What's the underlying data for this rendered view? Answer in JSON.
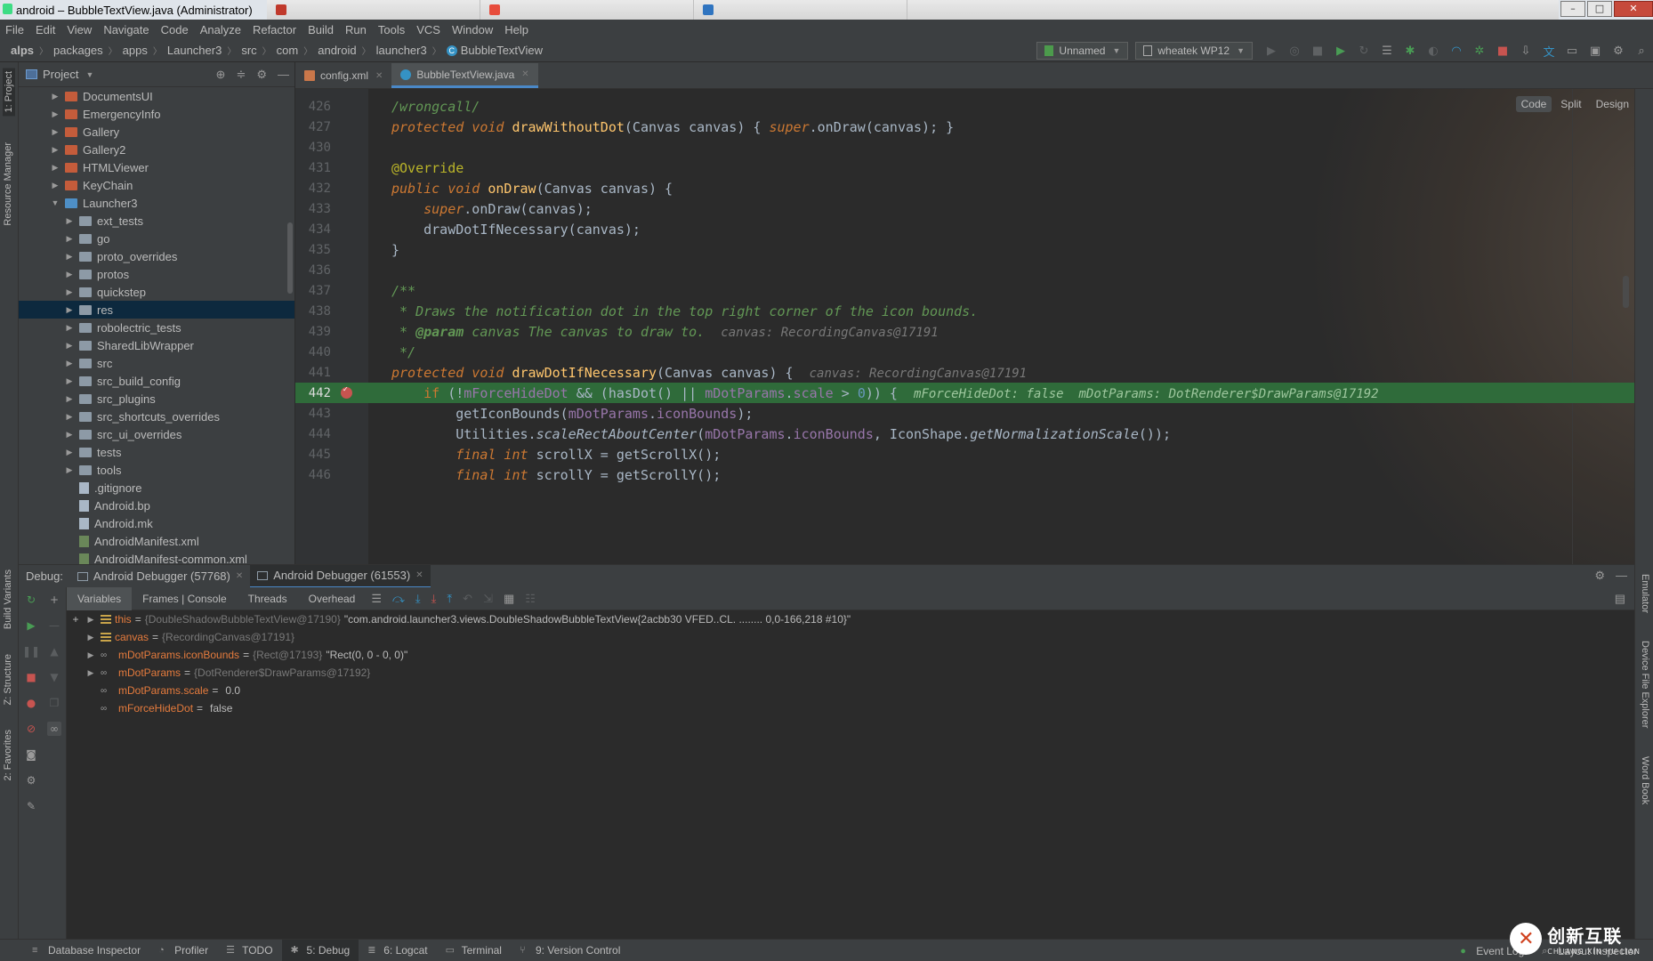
{
  "window": {
    "title": "android – BubbleTextView.java (Administrator)"
  },
  "menu": [
    "File",
    "Edit",
    "View",
    "Navigate",
    "Code",
    "Analyze",
    "Refactor",
    "Build",
    "Run",
    "Tools",
    "VCS",
    "Window",
    "Help"
  ],
  "breadcrumb": [
    "alps",
    "packages",
    "apps",
    "Launcher3",
    "src",
    "com",
    "android",
    "launcher3",
    "BubbleTextView"
  ],
  "toolbar": {
    "config_combo": "Unnamed",
    "device_combo": "wheatek WP12"
  },
  "project_panel": {
    "title": "Project",
    "tree": [
      {
        "label": "DocumentsUI",
        "kind": "module",
        "depth": 0,
        "arrow": "▶"
      },
      {
        "label": "EmergencyInfo",
        "kind": "module",
        "depth": 0,
        "arrow": "▶"
      },
      {
        "label": "Gallery",
        "kind": "module",
        "depth": 0,
        "arrow": "▶"
      },
      {
        "label": "Gallery2",
        "kind": "module",
        "depth": 0,
        "arrow": "▶"
      },
      {
        "label": "HTMLViewer",
        "kind": "module",
        "depth": 0,
        "arrow": "▶"
      },
      {
        "label": "KeyChain",
        "kind": "module",
        "depth": 0,
        "arrow": "▶"
      },
      {
        "label": "Launcher3",
        "kind": "open",
        "depth": 0,
        "arrow": "▼"
      },
      {
        "label": "ext_tests",
        "kind": "plain",
        "depth": 1,
        "arrow": "▶"
      },
      {
        "label": "go",
        "kind": "plain",
        "depth": 1,
        "arrow": "▶"
      },
      {
        "label": "proto_overrides",
        "kind": "plain",
        "depth": 1,
        "arrow": "▶"
      },
      {
        "label": "protos",
        "kind": "plain",
        "depth": 1,
        "arrow": "▶"
      },
      {
        "label": "quickstep",
        "kind": "plain",
        "depth": 1,
        "arrow": "▶"
      },
      {
        "label": "res",
        "kind": "plain",
        "depth": 1,
        "arrow": "▶",
        "selected": true
      },
      {
        "label": "robolectric_tests",
        "kind": "plain",
        "depth": 1,
        "arrow": "▶"
      },
      {
        "label": "SharedLibWrapper",
        "kind": "plain",
        "depth": 1,
        "arrow": "▶"
      },
      {
        "label": "src",
        "kind": "plain",
        "depth": 1,
        "arrow": "▶"
      },
      {
        "label": "src_build_config",
        "kind": "plain",
        "depth": 1,
        "arrow": "▶"
      },
      {
        "label": "src_plugins",
        "kind": "plain",
        "depth": 1,
        "arrow": "▶"
      },
      {
        "label": "src_shortcuts_overrides",
        "kind": "plain",
        "depth": 1,
        "arrow": "▶"
      },
      {
        "label": "src_ui_overrides",
        "kind": "plain",
        "depth": 1,
        "arrow": "▶"
      },
      {
        "label": "tests",
        "kind": "plain",
        "depth": 1,
        "arrow": "▶"
      },
      {
        "label": "tools",
        "kind": "plain",
        "depth": 1,
        "arrow": "▶"
      },
      {
        "label": ".gitignore",
        "kind": "file",
        "depth": 1,
        "arrow": ""
      },
      {
        "label": "Android.bp",
        "kind": "file",
        "depth": 1,
        "arrow": ""
      },
      {
        "label": "Android.mk",
        "kind": "file",
        "depth": 1,
        "arrow": ""
      },
      {
        "label": "AndroidManifest.xml",
        "kind": "xml",
        "depth": 1,
        "arrow": ""
      },
      {
        "label": "AndroidManifest-common.xml",
        "kind": "xml",
        "depth": 1,
        "arrow": ""
      }
    ]
  },
  "editor": {
    "tabs": [
      {
        "label": "config.xml",
        "active": false
      },
      {
        "label": "BubbleTextView.java",
        "active": true
      }
    ],
    "modes": [
      "Code",
      "Split",
      "Design"
    ],
    "lines": [
      {
        "n": "426",
        "html": "<span class=\"cm\">/wrongcall/</span>"
      },
      {
        "n": "427",
        "html": "<span class=\"kw\">protected void </span><span class=\"fn\">drawWithoutDot</span>(Canvas canvas) { <span class=\"kw\">super</span>.onDraw(canvas); }"
      },
      {
        "n": "430",
        "html": ""
      },
      {
        "n": "431",
        "html": "<span class=\"ann\">@Override</span>"
      },
      {
        "n": "432",
        "html": "<span class=\"kw\">public void </span><span class=\"fn\">onDraw</span>(Canvas canvas) {"
      },
      {
        "n": "433",
        "html": "    <span class=\"kw\">super</span>.onDraw(canvas);"
      },
      {
        "n": "434",
        "html": "    drawDotIfNecessary(canvas);"
      },
      {
        "n": "435",
        "html": "}"
      },
      {
        "n": "436",
        "html": ""
      },
      {
        "n": "437",
        "html": "<span class=\"cm\">/**</span>"
      },
      {
        "n": "438",
        "html": "<span class=\"cm\"> * Draws the notification dot in the top right corner of the icon bounds.</span>"
      },
      {
        "n": "439",
        "html": "<span class=\"cm\"> * </span><span class=\"tag\">@param</span><span class=\"cm\"> canvas The canvas to draw to.</span>  <span class=\"hint\">canvas: RecordingCanvas@17191</span>"
      },
      {
        "n": "440",
        "html": "<span class=\"cm\"> */</span>"
      },
      {
        "n": "441",
        "html": "<span class=\"kw\">protected void </span><span class=\"fn\">drawDotIfNecessary</span>(Canvas canvas) {  <span class=\"hint\">canvas: RecordingCanvas@17191</span>"
      },
      {
        "n": "442",
        "html": "    <span class=\"kw2\">if</span> (!<span class=\"fld\">mForceHideDot</span> && (hasDot() || <span class=\"fld\">mDotParams</span>.<span class=\"fld\">scale</span> > <span class=\"num\">0</span>)) {  <span class=\"hint\">mForceHideDot: false  mDotParams: DotRenderer$DrawParams@17192</span>",
        "exec": true,
        "bp": true
      },
      {
        "n": "443",
        "html": "        getIconBounds(<span class=\"fld\">mDotParams</span>.<span class=\"fld\">iconBounds</span>);"
      },
      {
        "n": "444",
        "html": "        Utilities.<span class=\"fn\" style=\"font-style:italic;color:#a9b7c6\">scaleRectAboutCenter</span>(<span class=\"fld\">mDotParams</span>.<span class=\"fld\">iconBounds</span>, IconShape.<span style=\"font-style:italic\">getNormalizationScale</span>());"
      },
      {
        "n": "445",
        "html": "        <span class=\"kw\">final int </span>scrollX = getScrollX();"
      },
      {
        "n": "446",
        "html": "        <span class=\"kw\">final int </span>scrollY = getScrollY();"
      }
    ]
  },
  "debug": {
    "label": "Debug:",
    "sessions": [
      {
        "label": "Android Debugger (57768)",
        "active": false
      },
      {
        "label": "Android Debugger (61553)",
        "active": true
      }
    ],
    "tabs": [
      "Variables",
      "Frames | Console",
      "Threads",
      "Overhead"
    ],
    "variables": [
      {
        "name": "this",
        "type": "{DoubleShadowBubbleTextView@17190}",
        "value": "\"com.android.launcher3.views.DoubleShadowBubbleTextView{2acbb30 VFED..CL. ........ 0,0-166,218 #10}\"",
        "expandable": true,
        "icon": "field"
      },
      {
        "name": "canvas",
        "type": "{RecordingCanvas@17191}",
        "value": "",
        "expandable": true,
        "icon": "field"
      },
      {
        "name": "mDotParams.iconBounds",
        "type": "{Rect@17193}",
        "value": "\"Rect(0, 0 - 0, 0)\"",
        "expandable": true,
        "icon": "watch"
      },
      {
        "name": "mDotParams",
        "type": "{DotRenderer$DrawParams@17192}",
        "value": "",
        "expandable": true,
        "icon": "watch"
      },
      {
        "name": "mDotParams.scale",
        "type": "",
        "value": "0.0",
        "expandable": false,
        "icon": "watch"
      },
      {
        "name": "mForceHideDot",
        "type": "",
        "value": "false",
        "expandable": false,
        "icon": "watch"
      }
    ]
  },
  "left_strip": [
    "1: Project",
    "Resource Manager",
    "Build Variants",
    "Z: Structure",
    "2: Favorites"
  ],
  "right_strip": [
    "Emulator",
    "Device File Explorer",
    "Word Book"
  ],
  "statusbar": {
    "items": [
      {
        "label": "Database Inspector",
        "icon": "≡"
      },
      {
        "label": "Profiler",
        "icon": "◔"
      },
      {
        "label": "TODO",
        "icon": "☰"
      },
      {
        "label": "5: Debug",
        "icon": "✱",
        "active": true
      },
      {
        "label": "6: Logcat",
        "icon": "≣"
      },
      {
        "label": "Terminal",
        "icon": "▭"
      },
      {
        "label": "9: Version Control",
        "icon": "⑂"
      }
    ],
    "right": [
      "Event Log",
      "Layout Inspector"
    ]
  },
  "watermark": {
    "cn": "创新互联",
    "en": "CHUANG XIN HU LIAN"
  }
}
